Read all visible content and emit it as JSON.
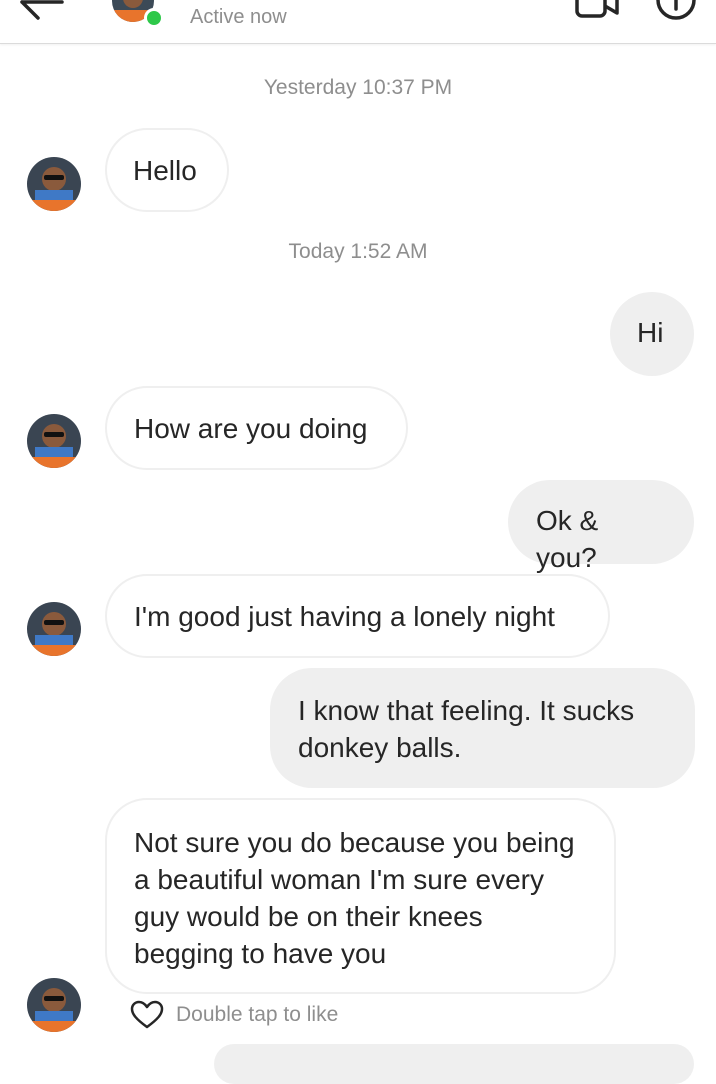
{
  "header": {
    "status": "Active now"
  },
  "colors": {
    "online": "#2ec84a",
    "incoming_border": "#efefef",
    "outgoing_bg": "#efefef",
    "meta_text": "#8e8e8e"
  },
  "messages": {
    "ts1": "Yesterday 10:37 PM",
    "m1": "Hello",
    "ts2": "Today 1:52 AM",
    "m2": "Hi",
    "m3": "How are you doing",
    "m4": "Ok & you?",
    "m5": "I'm good just having a lonely night",
    "m6": "I know that feeling. It sucks donkey balls.",
    "m7": "Not sure you do because you being a beautiful woman I'm sure every guy would be on their knees begging to have you"
  },
  "like_hint": {
    "label": "Double tap to like",
    "icon": "heart-outline-icon"
  }
}
